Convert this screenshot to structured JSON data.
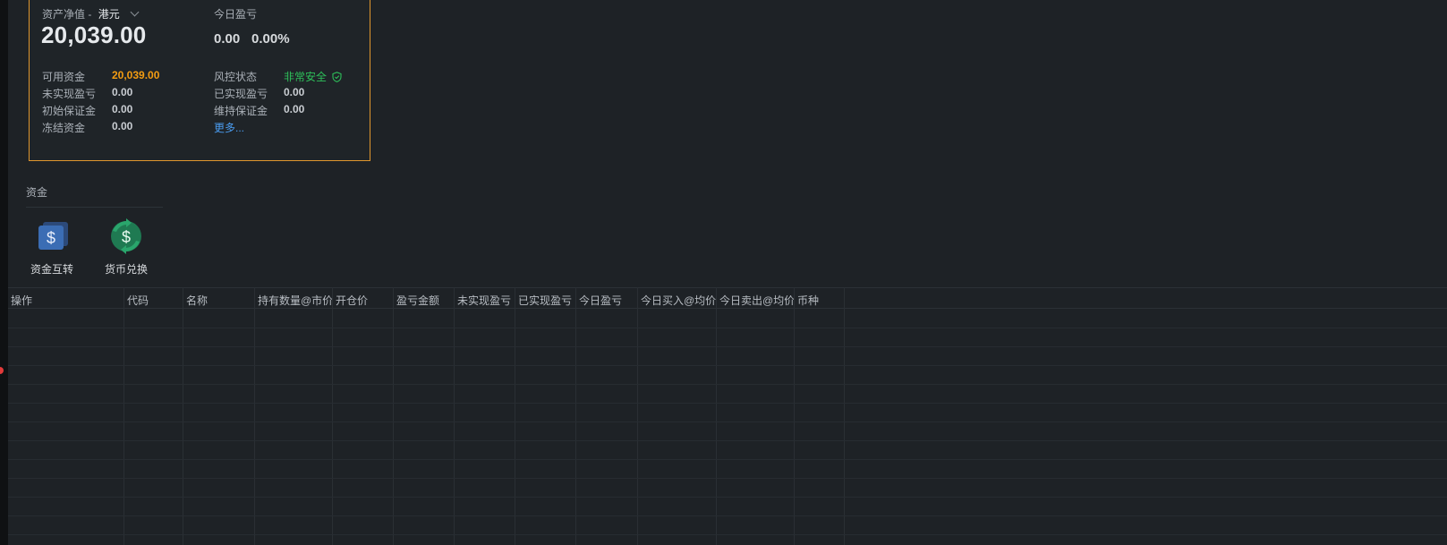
{
  "summary": {
    "net_asset_label": "资产净值 -",
    "currency": "港元",
    "net_asset_value": "20,039.00",
    "today_pnl_label": "今日盈亏",
    "today_pnl_value": "0.00",
    "today_pnl_pct": "0.00%",
    "rows_left": [
      {
        "label": "可用资金",
        "value": "20,039.00"
      },
      {
        "label": "未实现盈亏",
        "value": "0.00"
      },
      {
        "label": "初始保证金",
        "value": "0.00"
      },
      {
        "label": "冻结资金",
        "value": "0.00"
      }
    ],
    "rows_right": [
      {
        "label": "风控状态",
        "value": "非常安全"
      },
      {
        "label": "已实现盈亏",
        "value": "0.00"
      },
      {
        "label": "维持保证金",
        "value": "0.00"
      }
    ],
    "more_link": "更多...",
    "border_color": "#e0962e",
    "available_color": "#f39c12",
    "risk_color": "#2ec05a"
  },
  "funds": {
    "title": "资金",
    "tools": [
      {
        "label": "资金互转",
        "icon": "dollar-cards-icon"
      },
      {
        "label": "货币兑换",
        "icon": "currency-exchange-icon"
      }
    ]
  },
  "table": {
    "columns": [
      "操作",
      "代码",
      "名称",
      "持有数量@市价",
      "开仓价",
      "盈亏金额",
      "未实现盈亏",
      "已实现盈亏",
      "今日盈亏",
      "今日买入@均价",
      "今日卖出@均价",
      "币种"
    ],
    "rows": []
  }
}
